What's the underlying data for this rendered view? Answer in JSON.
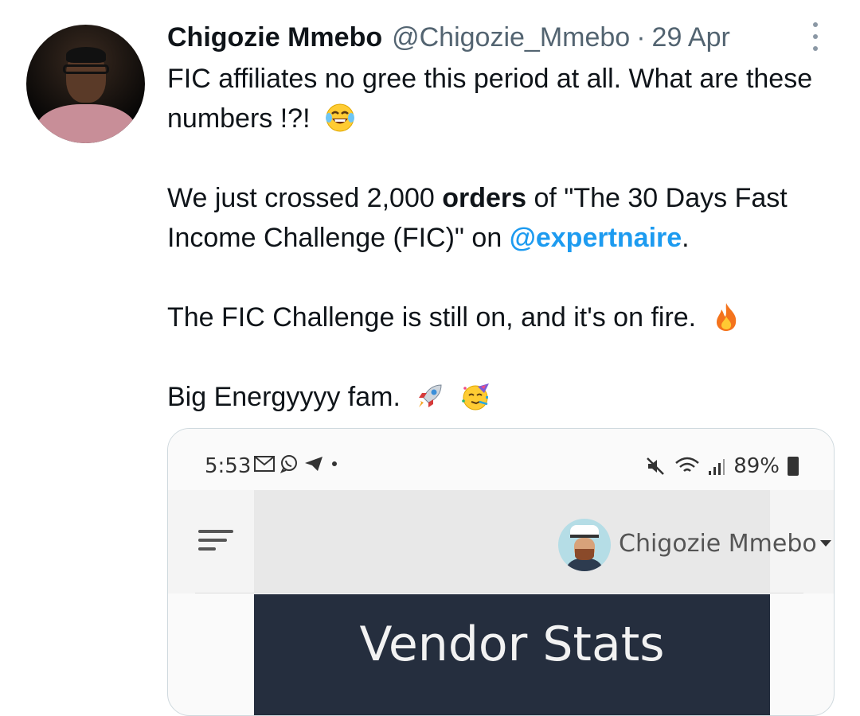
{
  "tweet": {
    "author_name": "Chigozie Mmebo",
    "handle": "@Chigozie_Mmebo",
    "separator": "·",
    "date": "29 Apr",
    "lines": {
      "p1": "FIC affiliates no gree this period at all. What are these numbers !?!",
      "p2_a": "We just crossed 2,000 ",
      "p2_bold": "orders",
      "p2_b": " of \"The 30 Days Fast Income Challenge (FIC)\" on ",
      "p2_mention": "@expertnaire",
      "p2_c": ".",
      "p3": "The FIC Challenge is still on, and it's on fire.",
      "p4": "Big Energyyyy fam."
    },
    "icons": [
      "avatar",
      "more-icon",
      "laughing-crying-emoji",
      "fire-emoji",
      "rocket-emoji",
      "party-face-emoji"
    ]
  },
  "screenshot": {
    "status_time": "5:53",
    "status_icons": [
      "gmail-icon",
      "whatsapp-icon",
      "telegram-icon",
      "dot-icon"
    ],
    "battery": "89%",
    "status_right_icons": [
      "mute-icon",
      "wifi-icon",
      "signal-icon",
      "battery-icon"
    ],
    "user_name": "Chigozie Mmebo",
    "banner_title": "Vendor Stats"
  },
  "colors": {
    "accent": "#1d9bf0",
    "muted": "#536471",
    "banner": "#252e3e"
  }
}
